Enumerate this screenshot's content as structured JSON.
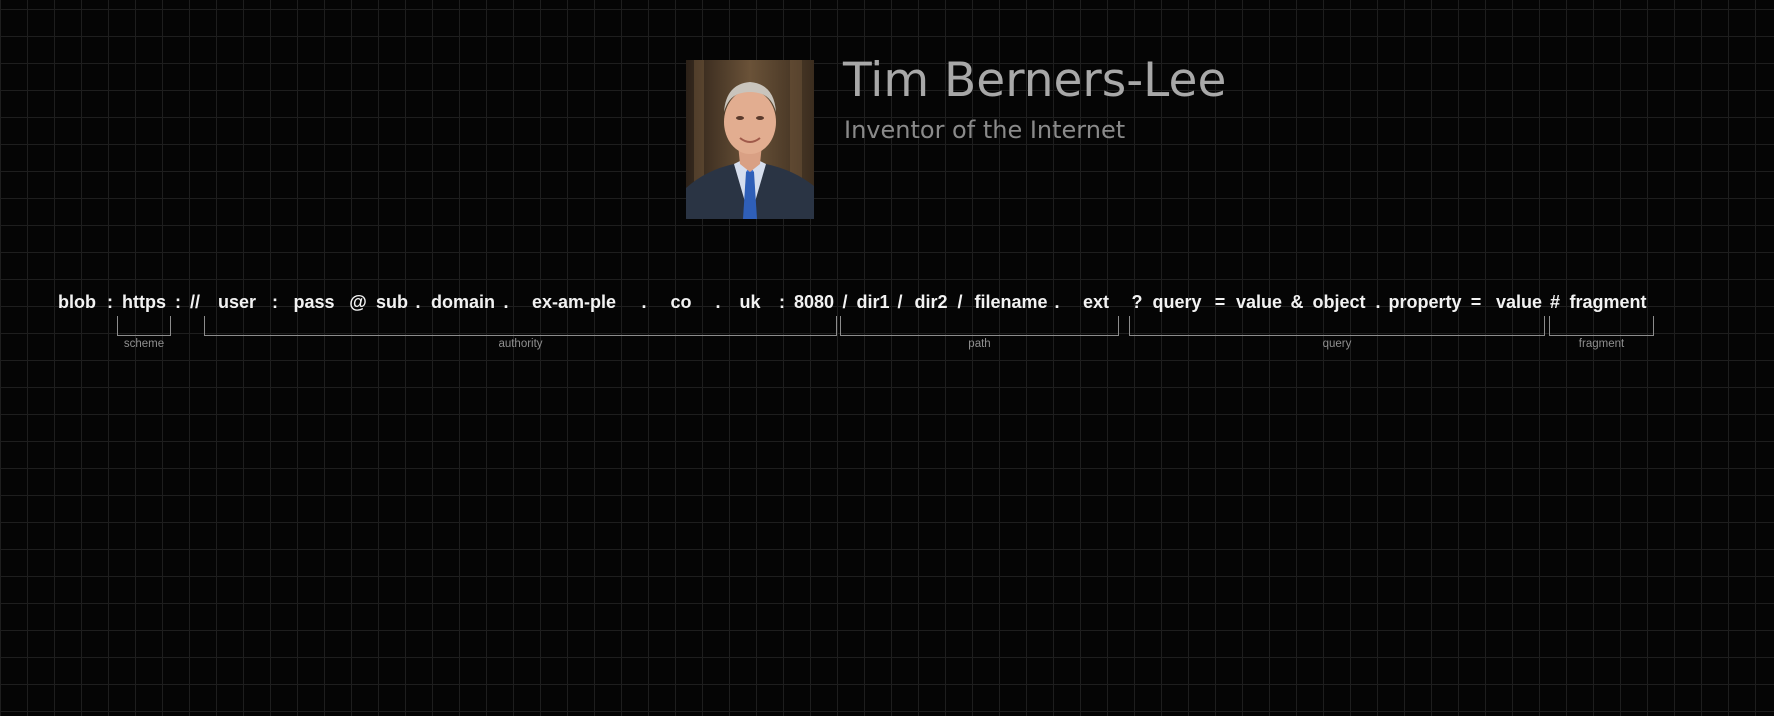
{
  "header": {
    "name": "Tim Berners-Lee",
    "subtitle": "Inventor of the Internet",
    "photo": "portrait-photo"
  },
  "url_tokens": [
    "blob",
    ":",
    "https",
    ":",
    "//",
    "user",
    ":",
    "pass",
    "@",
    "sub",
    ".",
    "domain",
    ".",
    "ex-am-ple",
    ".",
    "co",
    ".",
    "uk",
    ":",
    "8080",
    "/",
    "dir1",
    "/",
    "dir2",
    "/",
    "filename",
    ".",
    "ext",
    "?",
    "query",
    "=",
    "value",
    "&",
    "object",
    ".",
    "property",
    "=",
    "value",
    "#",
    "fragment"
  ],
  "segments": [
    {
      "label": "scheme"
    },
    {
      "label": "authority"
    },
    {
      "label": "path"
    },
    {
      "label": "query"
    },
    {
      "label": "fragment"
    }
  ],
  "colors": {
    "background": "#050505",
    "grid": "#1e1e1e",
    "token_text": "#f2f2f2",
    "label_text": "#8f8f8f"
  }
}
